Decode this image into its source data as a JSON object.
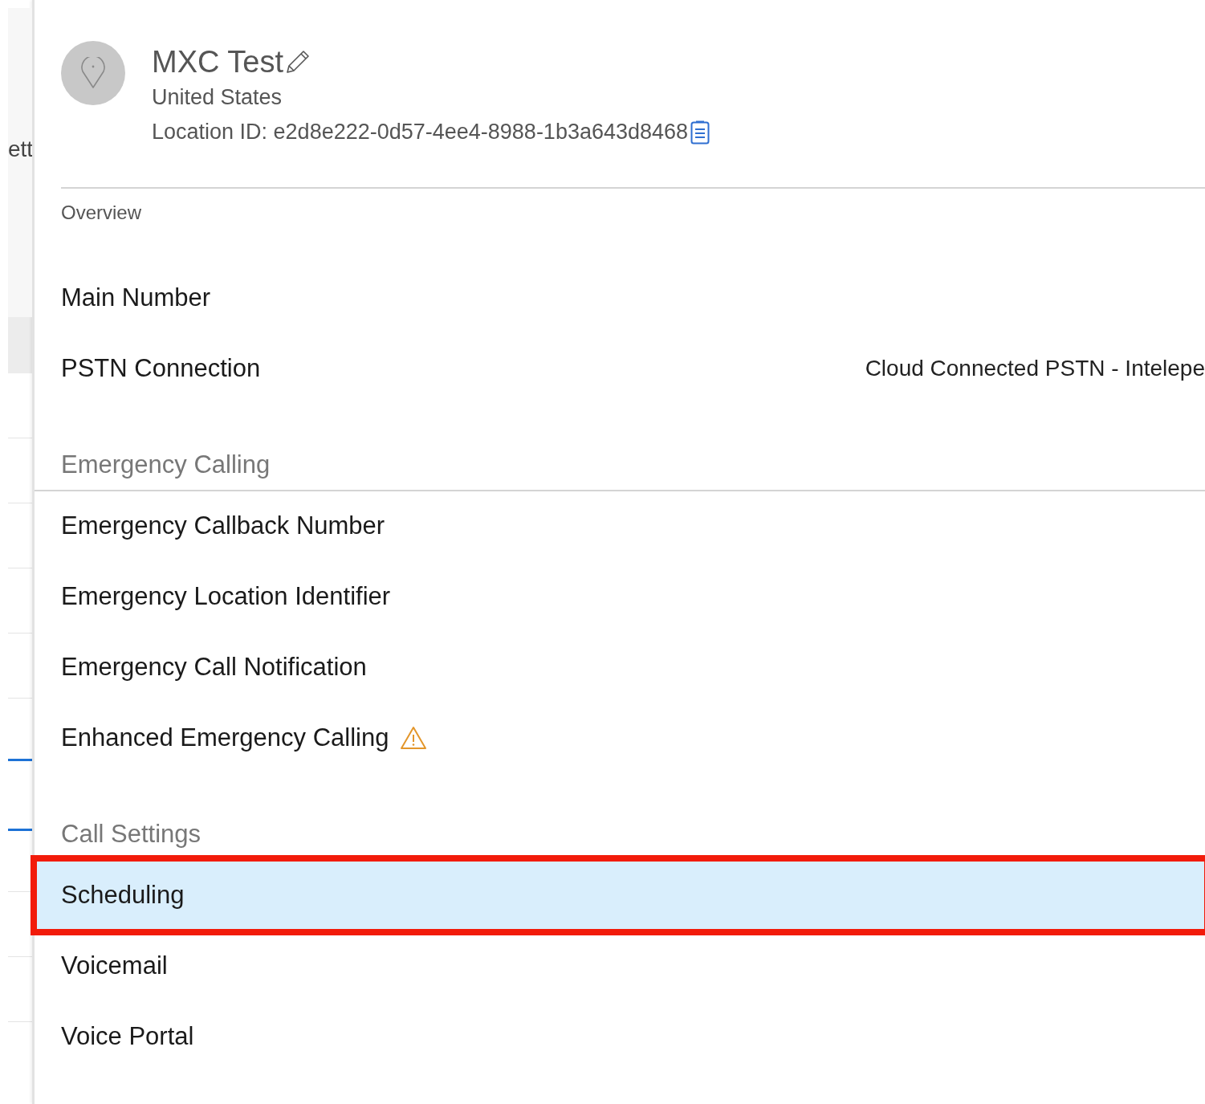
{
  "background_list": {
    "text": "ett"
  },
  "location": {
    "name": "MXC Test",
    "country": "United States",
    "location_id": "Location ID: e2d8e222-0d57-4ee4-8988-1b3a643d8468"
  },
  "tab": "Overview",
  "sections": [
    {
      "items": [
        {
          "label": "Main Number",
          "warning": false,
          "selected": false,
          "annotated": false
        },
        {
          "label": "PSTN Connection",
          "value": "Cloud Connected PSTN - Intelepe",
          "warning": false,
          "selected": false,
          "annotated": false
        }
      ]
    },
    {
      "heading": "Emergency Calling",
      "items": [
        {
          "label": "Emergency Callback Number",
          "warning": false,
          "selected": false,
          "annotated": false
        },
        {
          "label": "Emergency Location Identifier",
          "warning": false,
          "selected": false,
          "annotated": false
        },
        {
          "label": "Emergency Call Notification",
          "warning": false,
          "selected": false,
          "annotated": false
        },
        {
          "label": "Enhanced Emergency Calling",
          "warning": true,
          "selected": false,
          "annotated": false
        }
      ]
    },
    {
      "heading": "Call Settings",
      "items": [
        {
          "label": "Scheduling",
          "warning": false,
          "selected": true,
          "annotated": true
        },
        {
          "label": "Voicemail",
          "warning": false,
          "selected": false,
          "annotated": false
        },
        {
          "label": "Voice Portal",
          "warning": false,
          "selected": false,
          "annotated": false
        }
      ]
    }
  ]
}
